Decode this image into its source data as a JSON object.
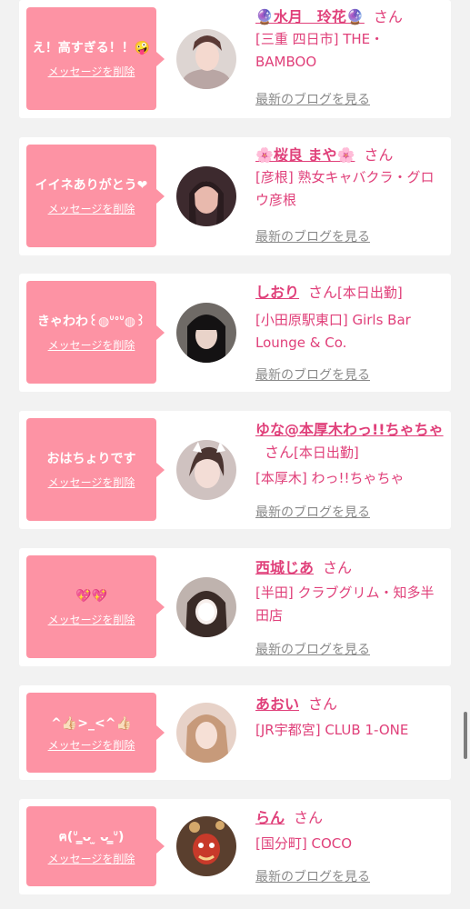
{
  "colors": {
    "accent": "#fd93a4",
    "name_pink": "#e0407a",
    "link_gray": "#8a8a8a",
    "background": "#f2f2f2"
  },
  "delete_label": "メッセージを削除",
  "blog_label": "最新のブログを見る",
  "san": "さん",
  "items": [
    {
      "message": "え！高すぎる！！🤪",
      "name": "🔮水月　玲花🔮",
      "shop": "[三重 四日市] THE・BAMBOO",
      "status": ""
    },
    {
      "message": "イイネありがとう❤",
      "name": "🌸桜良 まや🌸",
      "shop": "[彦根] 熟女キャバクラ・グロウ彦根",
      "status": ""
    },
    {
      "message": "きゃわわ꒰◍ᐡᐤᐡ◍꒱",
      "name": "しおり",
      "shop": "[小田原駅東口] Girls Bar Lounge & Co.",
      "status": "[本日出勤]"
    },
    {
      "message": "おはちょりです",
      "name": "ゆな@本厚木わっ!!ちゃちゃ",
      "shop": "[本厚木] わっ!!ちゃちゃ",
      "status": "[本日出勤]"
    },
    {
      "message": "💖💖",
      "name": "西城じあ",
      "shop": "[半田] クラブグリム・知多半田店",
      "status": ""
    },
    {
      "message": "^👍🏻>_<^👍🏻",
      "name": "あおい",
      "shop": "[JR宇都宮] CLUB 1-ONE",
      "status": ""
    },
    {
      "message": "ฅ(ᐡ ̳ᴗ ̫ ᴗ ̳ᐡ)",
      "name": "らん",
      "shop": "[国分町] COCO",
      "status": ""
    }
  ]
}
